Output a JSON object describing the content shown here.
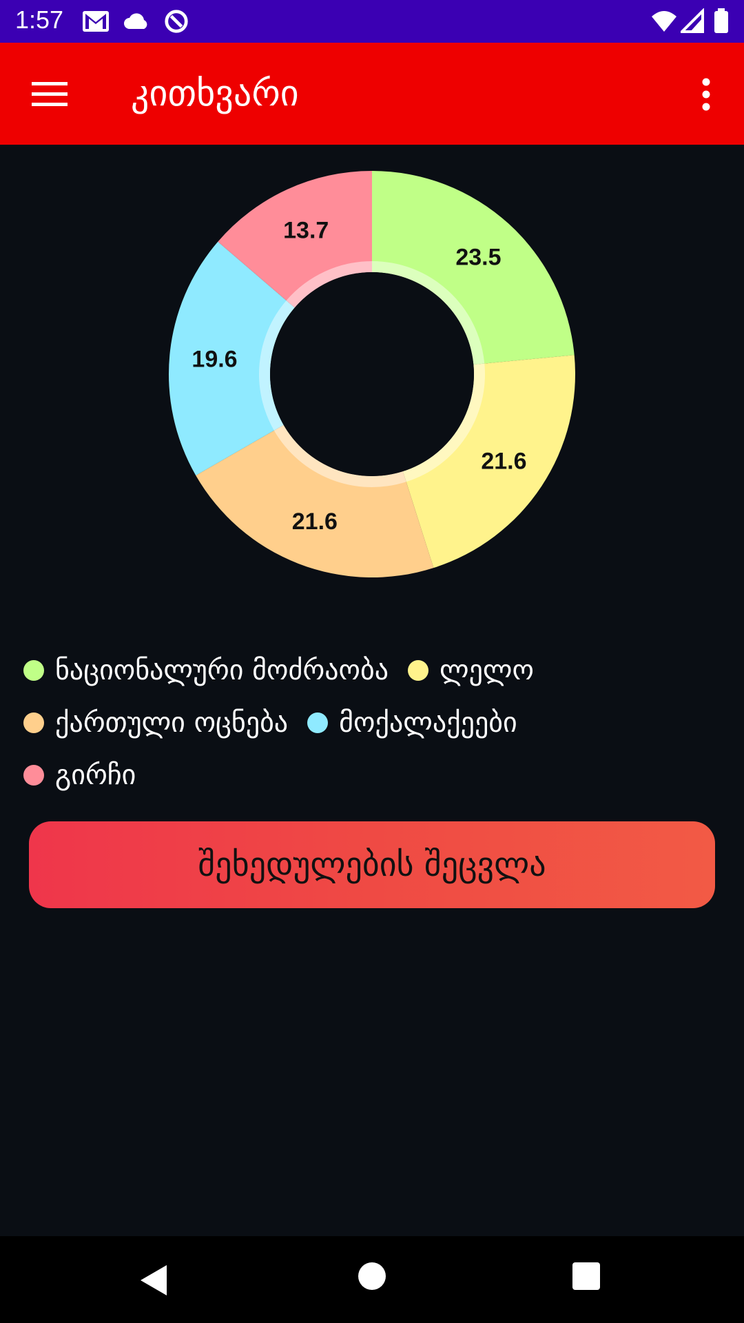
{
  "status_bar": {
    "time": "1:57",
    "icons": [
      "gmail-icon",
      "cloud-icon",
      "sync-icon",
      "wifi-icon",
      "signal-icon",
      "battery-icon"
    ]
  },
  "app_bar": {
    "title": "კითხვარი",
    "color": "#ee0000"
  },
  "chart_data": {
    "type": "pie",
    "variant": "donut",
    "categories": [
      "ნაციონალური მოძრაობა",
      "ლელო",
      "ქართული ოცნება",
      "მოქალაქეები",
      "გირჩი"
    ],
    "values": [
      23.5,
      21.6,
      21.6,
      19.6,
      13.7
    ],
    "labels": [
      "23.5",
      "21.6",
      "21.6",
      "19.6",
      "13.7"
    ],
    "colors": [
      "#c0ff87",
      "#fff38c",
      "#ffcf8c",
      "#8feaff",
      "#ff8d99"
    ],
    "legend_position": "bottom-left"
  },
  "button": {
    "label": "შეხედულების შეცვლა"
  },
  "nav_bar": {
    "icons": [
      "back-icon",
      "home-icon",
      "recents-icon"
    ]
  }
}
